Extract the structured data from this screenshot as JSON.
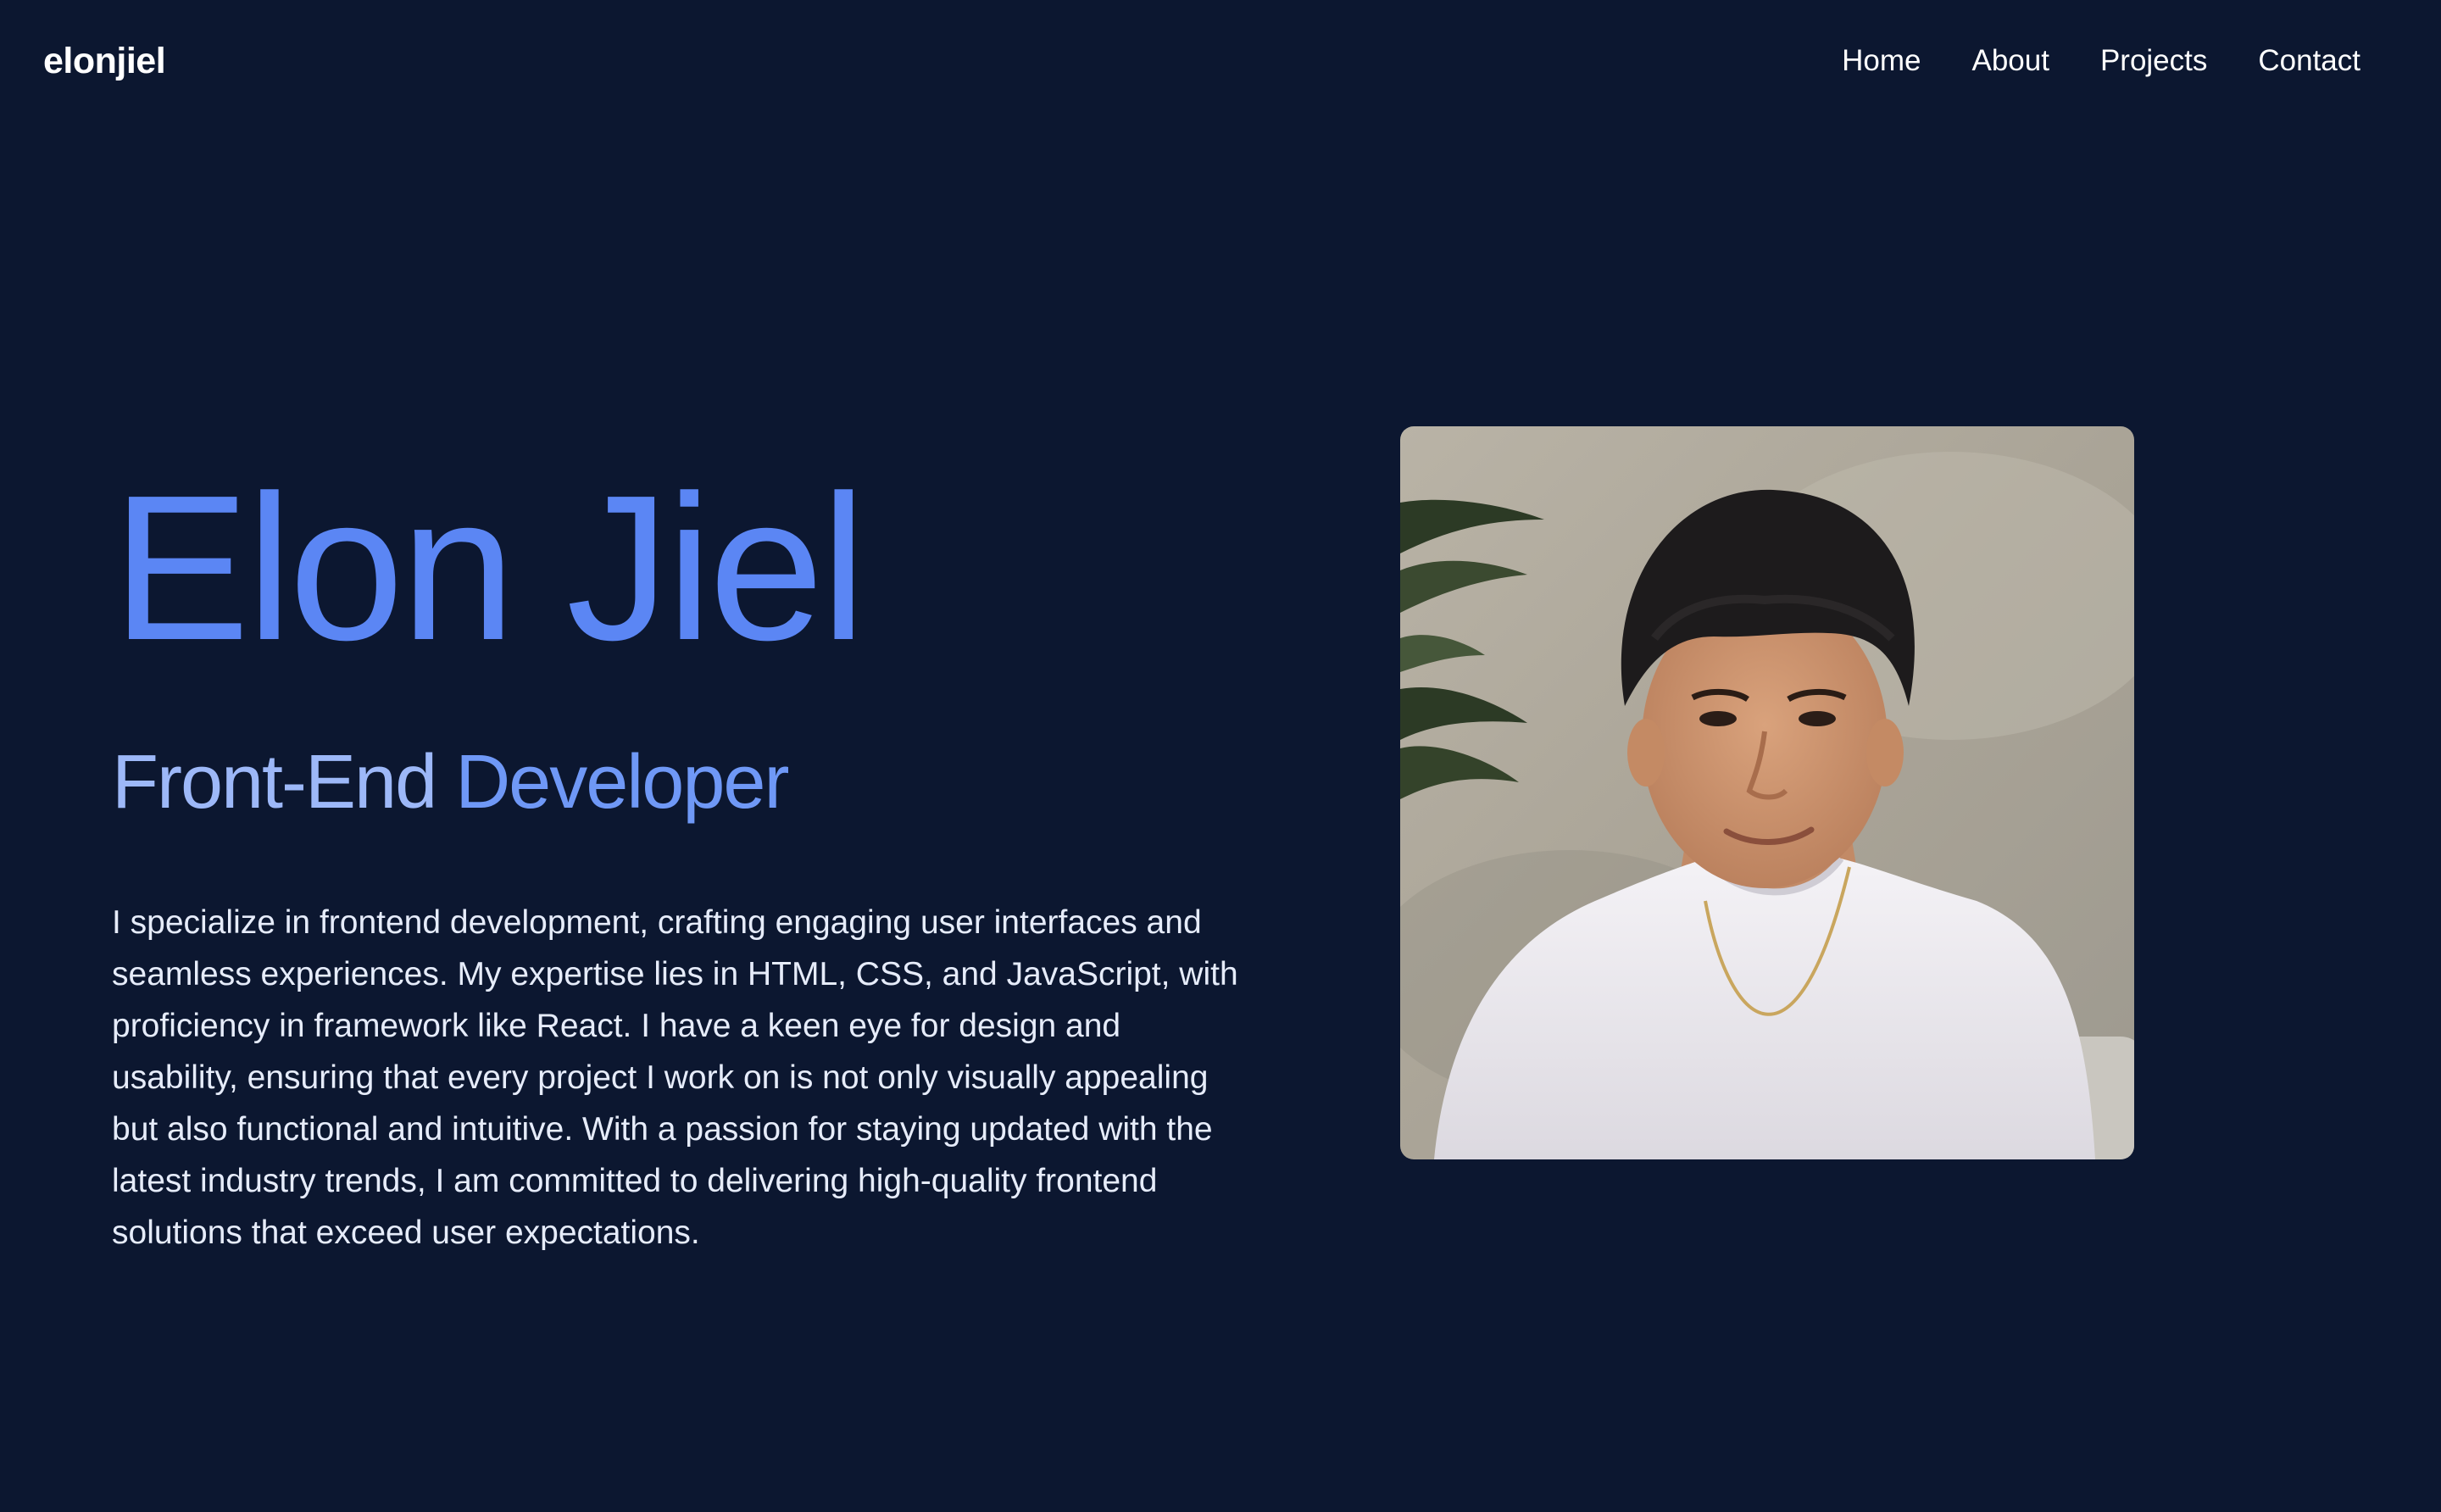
{
  "header": {
    "logo": "elonjiel",
    "nav": [
      {
        "label": "Home"
      },
      {
        "label": "About"
      },
      {
        "label": "Projects"
      },
      {
        "label": "Contact"
      }
    ]
  },
  "hero": {
    "name": "Elon Jiel",
    "role_part1": "Front-End",
    "role_part2": "Developer",
    "bio": "I specialize in frontend development, crafting engaging user interfaces and seamless experiences. My expertise lies in HTML, CSS, and JavaScript, with proficiency in framework like React. I have a keen eye for design and usability, ensuring that every project I work on is not only visually appealing but also functional and intuitive. With a passion for staying updated with the latest industry trends, I am committed to delivering high-quality frontend solutions that exceed user expectations."
  },
  "colors": {
    "background": "#0c1730",
    "accent": "#5b86f4",
    "role_light": "#9db8f8",
    "text": "#e6ecfa"
  },
  "photo": {
    "icon": "profile-photo"
  }
}
